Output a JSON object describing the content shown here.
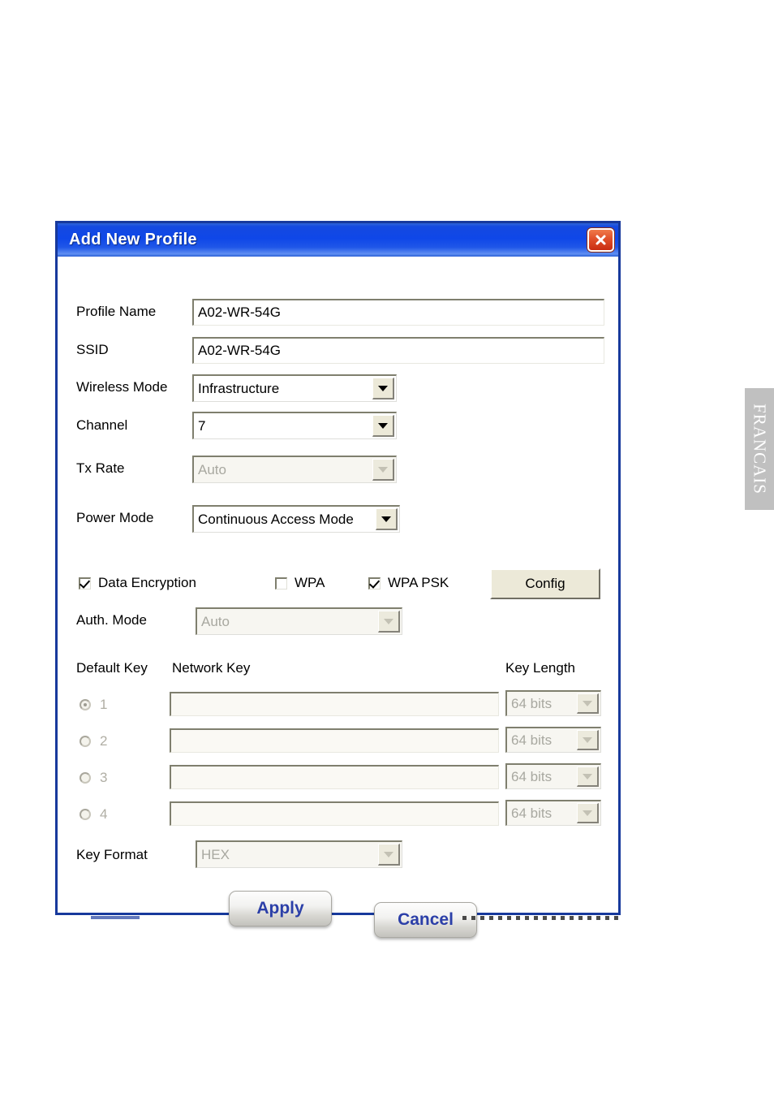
{
  "page": {
    "side_tab_label": "FRANCAIS"
  },
  "dialog": {
    "title": "Add New Profile",
    "close_icon": "close-icon",
    "fields": {
      "profile_name": {
        "label": "Profile Name",
        "value": "A02-WR-54G"
      },
      "ssid": {
        "label": "SSID",
        "value": "A02-WR-54G"
      },
      "wireless_mode": {
        "label": "Wireless Mode",
        "value": "Infrastructure",
        "enabled": true
      },
      "channel": {
        "label": "Channel",
        "value": "7",
        "enabled": true
      },
      "tx_rate": {
        "label": "Tx Rate",
        "value": "Auto",
        "enabled": false
      },
      "power_mode": {
        "label": "Power Mode",
        "value": "Continuous Access Mode",
        "enabled": true
      }
    },
    "security": {
      "data_encryption": {
        "label": "Data Encryption",
        "checked": true
      },
      "wpa": {
        "label": "WPA",
        "checked": false
      },
      "wpa_psk": {
        "label": "WPA PSK",
        "checked": true
      },
      "config_button": "Config",
      "auth_mode": {
        "label": "Auth. Mode",
        "value": "Auto",
        "enabled": false
      }
    },
    "key_table": {
      "headers": {
        "default_key": "Default Key",
        "network_key": "Network Key",
        "key_length": "Key Length"
      },
      "rows": [
        {
          "index": "1",
          "selected": true,
          "network_key": "",
          "key_length": "64 bits"
        },
        {
          "index": "2",
          "selected": false,
          "network_key": "",
          "key_length": "64 bits"
        },
        {
          "index": "3",
          "selected": false,
          "network_key": "",
          "key_length": "64 bits"
        },
        {
          "index": "4",
          "selected": false,
          "network_key": "",
          "key_length": "64 bits"
        }
      ]
    },
    "key_format": {
      "label": "Key Format",
      "value": "HEX",
      "enabled": false
    },
    "buttons": {
      "apply": "Apply",
      "cancel": "Cancel"
    }
  }
}
